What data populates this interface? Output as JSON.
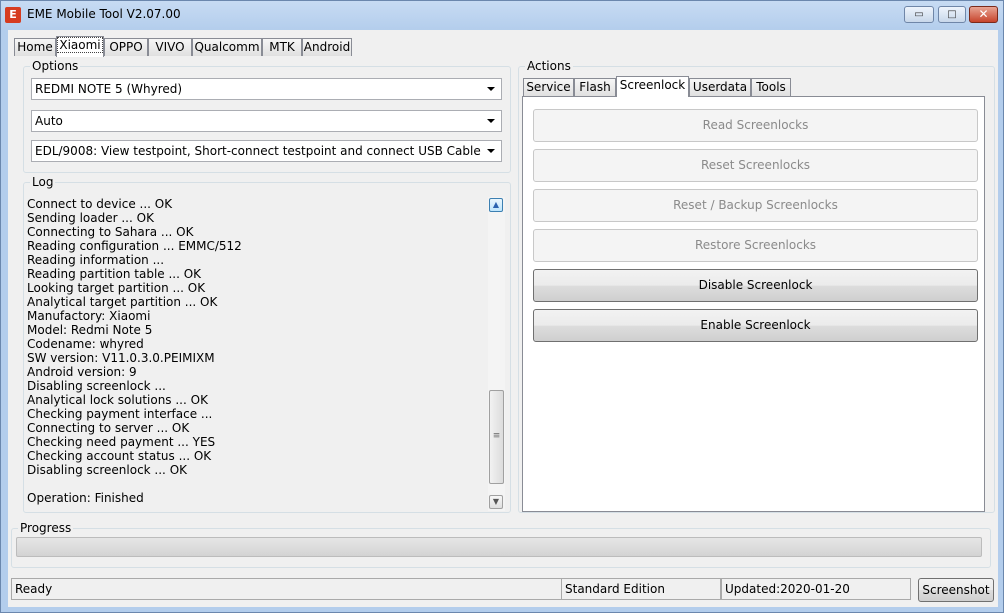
{
  "window": {
    "title": "EME Mobile Tool V2.07.00",
    "icon_letter": "E",
    "controls": {
      "minimize": "▭",
      "maximize": "□",
      "close": "✕"
    }
  },
  "main_tabs": [
    "Home",
    "Xiaomi",
    "OPPO",
    "VIVO",
    "Qualcomm",
    "MTK",
    "Android"
  ],
  "active_main_tab": "Xiaomi",
  "options": {
    "label": "Options",
    "model": "REDMI NOTE 5 (Whyred)",
    "mode": "Auto",
    "connection": "EDL/9008: View testpoint, Short-connect testpoint and connect USB Cable"
  },
  "log": {
    "label": "Log",
    "lines": [
      "Connect to device ... OK",
      "Sending loader ... OK",
      "Connecting to Sahara ... OK",
      "Reading configuration ... EMMC/512",
      "Reading information ...",
      "Reading partition table ... OK",
      "Looking target partition ... OK",
      "Analytical target partition ... OK",
      "Manufactory: Xiaomi",
      "Model: Redmi Note 5",
      "Codename: whyred",
      "SW version: V11.0.3.0.PEIMIXM",
      "Android version: 9",
      "Disabling screenlock ...",
      "Analytical lock solutions ... OK",
      "Checking payment interface ...",
      "Connecting to server ... OK",
      "Checking need payment ... YES",
      "Checking account status ... OK",
      "Disabling screenlock ... OK",
      "",
      "Operation: Finished"
    ]
  },
  "actions": {
    "label": "Actions",
    "tabs": [
      "Service",
      "Flash",
      "Screenlock",
      "Userdata",
      "Tools"
    ],
    "active_tab": "Screenlock",
    "buttons": [
      {
        "label": "Read Screenlocks",
        "enabled": false
      },
      {
        "label": "Reset Screenlocks",
        "enabled": false
      },
      {
        "label": "Reset / Backup Screenlocks",
        "enabled": false
      },
      {
        "label": "Restore Screenlocks",
        "enabled": false
      },
      {
        "label": "Disable Screenlock",
        "enabled": true
      },
      {
        "label": "Enable Screenlock",
        "enabled": true
      }
    ]
  },
  "progress": {
    "label": "Progress",
    "value": 0
  },
  "status": {
    "state": "Ready",
    "edition": "Standard Edition",
    "updated": "Updated:2020-01-20",
    "screenshot_button": "Screenshot"
  }
}
